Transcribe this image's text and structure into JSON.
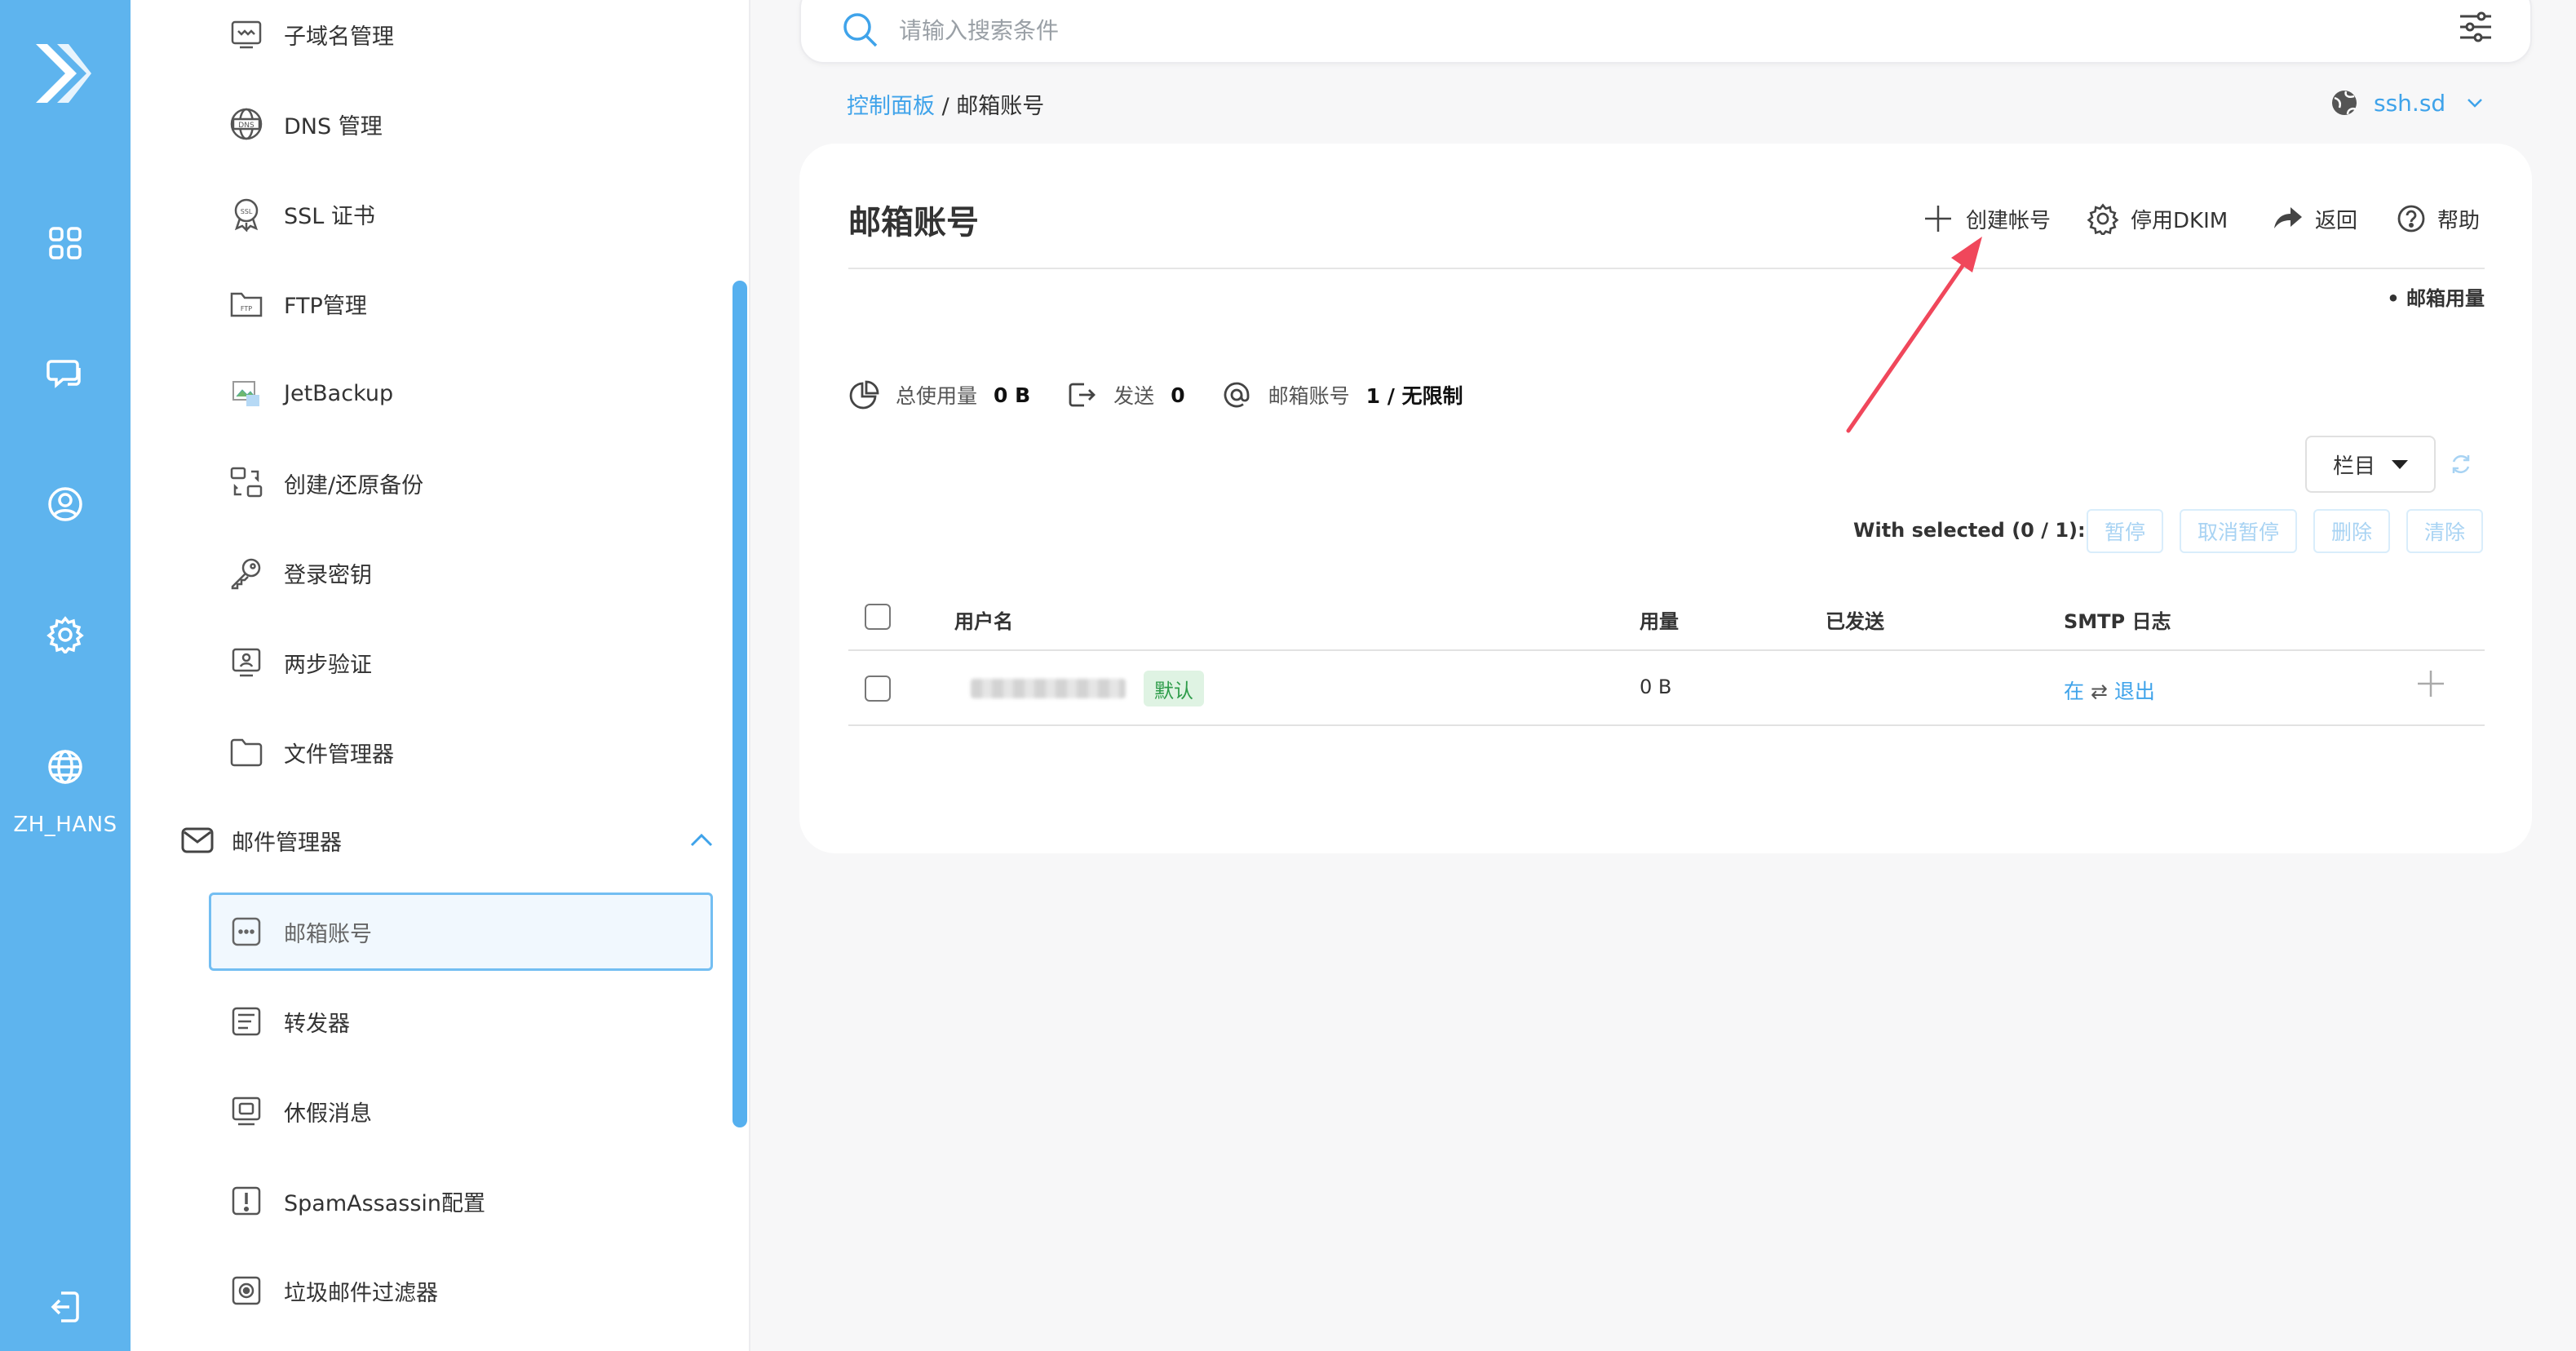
{
  "rail": {
    "lang_label": "ZH_HANS",
    "brand_color": "#5eb4ee",
    "items": [
      {
        "name": "apps-grid-icon"
      },
      {
        "name": "chat-icon"
      },
      {
        "name": "user-icon"
      },
      {
        "name": "gear-icon"
      },
      {
        "name": "globe-icon"
      },
      {
        "name": "logout-icon"
      }
    ]
  },
  "sidebar": {
    "items": [
      {
        "label": "子域名管理",
        "icon": "subdomain-icon"
      },
      {
        "label": "DNS 管理",
        "icon": "dns-icon"
      },
      {
        "label": "SSL 证书",
        "icon": "ssl-icon"
      },
      {
        "label": "FTP管理",
        "icon": "ftp-folder-icon"
      },
      {
        "label": "JetBackup",
        "icon": "broken-image-icon"
      },
      {
        "label": "创建/还原备份",
        "icon": "backup-icon"
      },
      {
        "label": "登录密钥",
        "icon": "key-icon"
      },
      {
        "label": "两步验证",
        "icon": "two-factor-icon"
      },
      {
        "label": "文件管理器",
        "icon": "folder-icon"
      }
    ],
    "group": {
      "label": "邮件管理器",
      "icon": "mail-icon"
    },
    "sub_items": [
      {
        "label": "邮箱账号",
        "icon": "mailbox-icon"
      },
      {
        "label": "转发器",
        "icon": "forwarder-icon"
      },
      {
        "label": "休假消息",
        "icon": "vacation-icon"
      },
      {
        "label": "SpamAssassin配置",
        "icon": "spam-alert-icon"
      },
      {
        "label": "垃圾邮件过滤器",
        "icon": "spam-filter-icon"
      }
    ]
  },
  "search": {
    "placeholder": "请输入搜索条件",
    "value": ""
  },
  "breadcrumb": {
    "root": "控制面板",
    "separator": " / ",
    "current": "邮箱账号"
  },
  "domain_select": {
    "value": "ssh.sd"
  },
  "card": {
    "title": "邮箱账号",
    "toolbar": {
      "create": "创建帐号",
      "dkim": "停用DKIM",
      "back": "返回",
      "help": "帮助"
    },
    "usage_link": "• 邮箱用量",
    "stats": {
      "total_label": "总使用量",
      "total_value": "0 B",
      "sent_label": "发送",
      "sent_value": "0",
      "accounts_label": "邮箱账号",
      "accounts_value": "1 / 无限制"
    },
    "columns_button": "栏目",
    "with_selected": "With selected (0 / 1):",
    "bulk": {
      "suspend": "暂停",
      "unsuspend": "取消暂停",
      "delete": "删除",
      "purge": "清除"
    },
    "table": {
      "headers": {
        "username": "用户名",
        "usage": "用量",
        "sent": "已发送",
        "smtp_log": "SMTP 日志"
      },
      "rows": [
        {
          "badge": "默认",
          "usage": "0 B",
          "smtp_in": "在",
          "smtp_swap": "⇄",
          "smtp_out": "退出"
        }
      ]
    }
  },
  "colors": {
    "accent": "#3fa3ea",
    "annotation_arrow": "#f0475b",
    "badge_bg": "#dff3e3",
    "badge_fg": "#2e9c4a"
  }
}
